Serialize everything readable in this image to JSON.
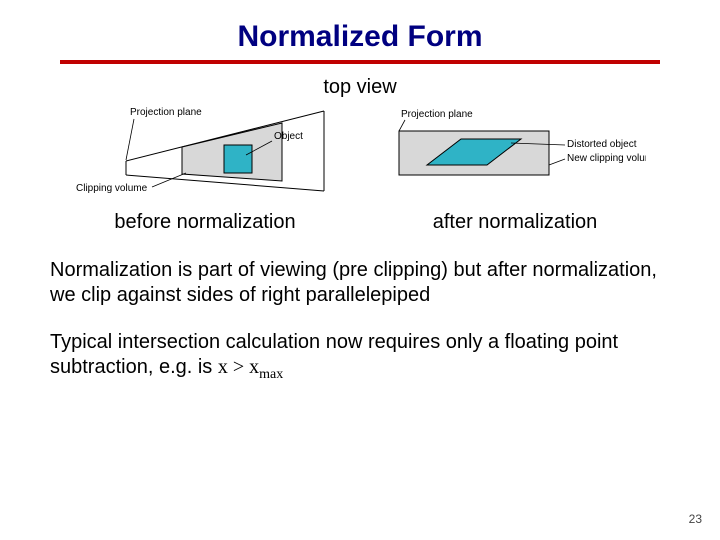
{
  "title": "Normalized Form",
  "topview": "top view",
  "fig_before": {
    "proj_plane": "Projection plane",
    "object": "Object",
    "clipping": "Clipping volume"
  },
  "fig_after": {
    "proj_plane": "Projection plane",
    "distorted": "Distorted object",
    "new_clip": "New clipping volume"
  },
  "caption_before": "before normalization",
  "caption_after": "after normalization",
  "para1": "Normalization is part of viewing (pre clipping) but after normalization, we clip against sides of right parallelepiped",
  "para2": "Typical intersection calculation now requires only a floating point subtraction, e.g. is ",
  "x": "x",
  "gt": " > ",
  "xmax_x": "x",
  "xmax_sub": "max",
  "page": "23"
}
